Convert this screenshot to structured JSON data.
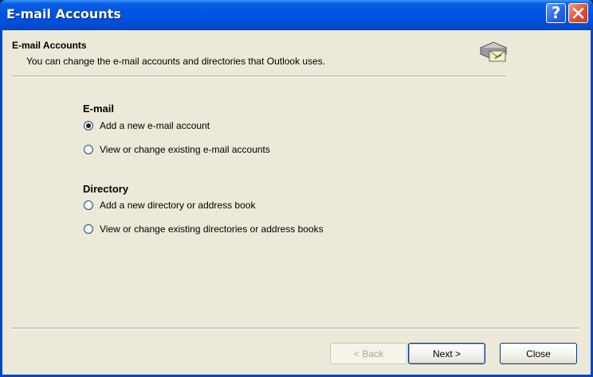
{
  "window": {
    "title": "E-mail Accounts",
    "help_icon": "help-icon",
    "close_icon": "close-icon"
  },
  "header": {
    "title": "E-mail Accounts",
    "subtitle": "You can change the e-mail accounts and directories that Outlook uses.",
    "icon": "email-accounts-icon"
  },
  "email_group": {
    "label": "E-mail",
    "options": [
      {
        "label": "Add a new e-mail account",
        "checked": true
      },
      {
        "label": "View or change existing e-mail accounts",
        "checked": false
      }
    ]
  },
  "directory_group": {
    "label": "Directory",
    "options": [
      {
        "label": "Add a new directory or address book",
        "checked": false
      },
      {
        "label": "View or change existing directories or address books",
        "checked": false
      }
    ]
  },
  "buttons": {
    "back": "< Back",
    "next": "Next >",
    "close": "Close"
  },
  "colors": {
    "titlebar": "#0054E3",
    "client_bg": "#ECE9D8",
    "close_button": "#E0502F"
  }
}
